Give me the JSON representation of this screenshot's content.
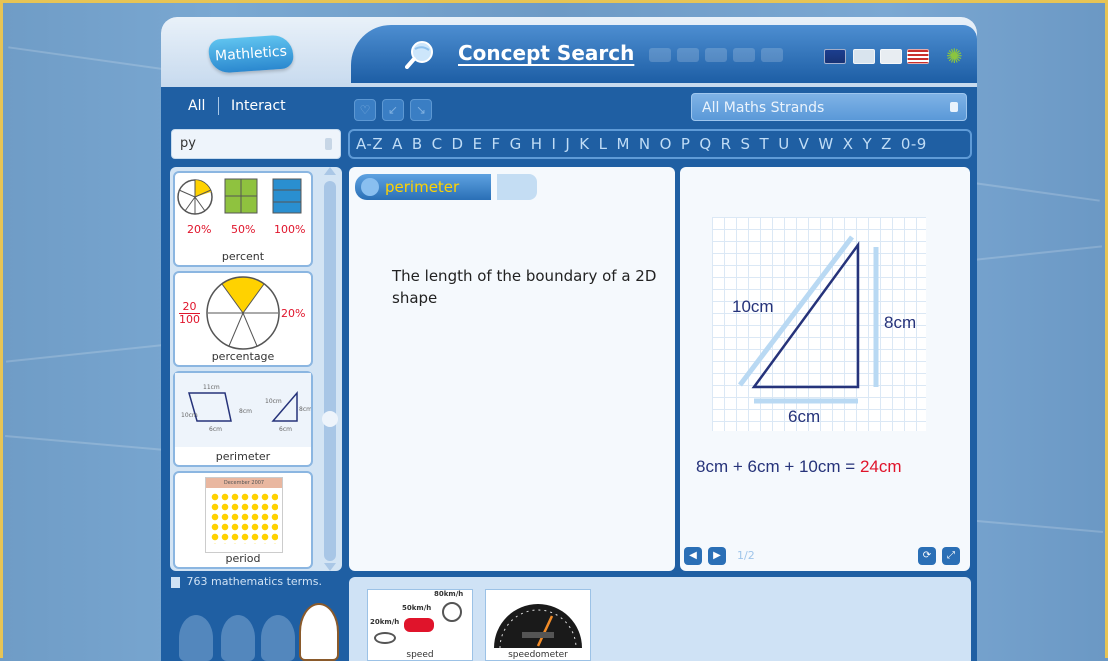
{
  "app": {
    "logo_text": "Mathletics",
    "title": "Concept Search",
    "icons": [
      "magnifier-globe-icon",
      "australia-flag-icon",
      "uk-flag-icon",
      "canada-flag-icon",
      "usa-flag-icon",
      "gear-icon"
    ]
  },
  "nav": {
    "tab_all": "All",
    "tab_interact": "Interact",
    "strand_select": "All Maths Strands"
  },
  "search": {
    "value": "py"
  },
  "alphabet": [
    "A-Z",
    "A",
    "B",
    "C",
    "D",
    "E",
    "F",
    "G",
    "H",
    "I",
    "J",
    "K",
    "L",
    "M",
    "N",
    "O",
    "P",
    "Q",
    "R",
    "S",
    "T",
    "U",
    "V",
    "W",
    "X",
    "Y",
    "Z",
    "0-9"
  ],
  "terms": [
    {
      "label": "percent",
      "values": [
        "20%",
        "50%",
        "100%"
      ]
    },
    {
      "label": "percentage",
      "fraction_num": "20",
      "fraction_den": "100",
      "percent": "20%"
    },
    {
      "label": "perimeter",
      "mini_labels": [
        "11cm",
        "10cm",
        "6cm",
        "10cm",
        "8cm",
        "8cm",
        "6cm"
      ]
    },
    {
      "label": "period",
      "calendar_title": "December 2007"
    }
  ],
  "selected": {
    "term": "perimeter",
    "definition": "The length of the boundary of a 2D shape",
    "diagram": {
      "hyp": "10cm",
      "height": "8cm",
      "base": "6cm"
    },
    "equation_terms": "8cm + 6cm + 10cm =",
    "equation_result": "24cm",
    "page": "1/2"
  },
  "footer": {
    "term_count": "763 mathematics terms.",
    "avatars": [
      "1",
      "2",
      "3",
      "4"
    ]
  },
  "related": [
    {
      "label": "speed",
      "values": [
        "20km/h",
        "50km/h",
        "80km/h"
      ]
    },
    {
      "label": "speedometer"
    }
  ],
  "colors": {
    "accent_yellow": "#ffd200",
    "result_red": "#e0142b",
    "frame_blue": "#1f5fa3"
  }
}
